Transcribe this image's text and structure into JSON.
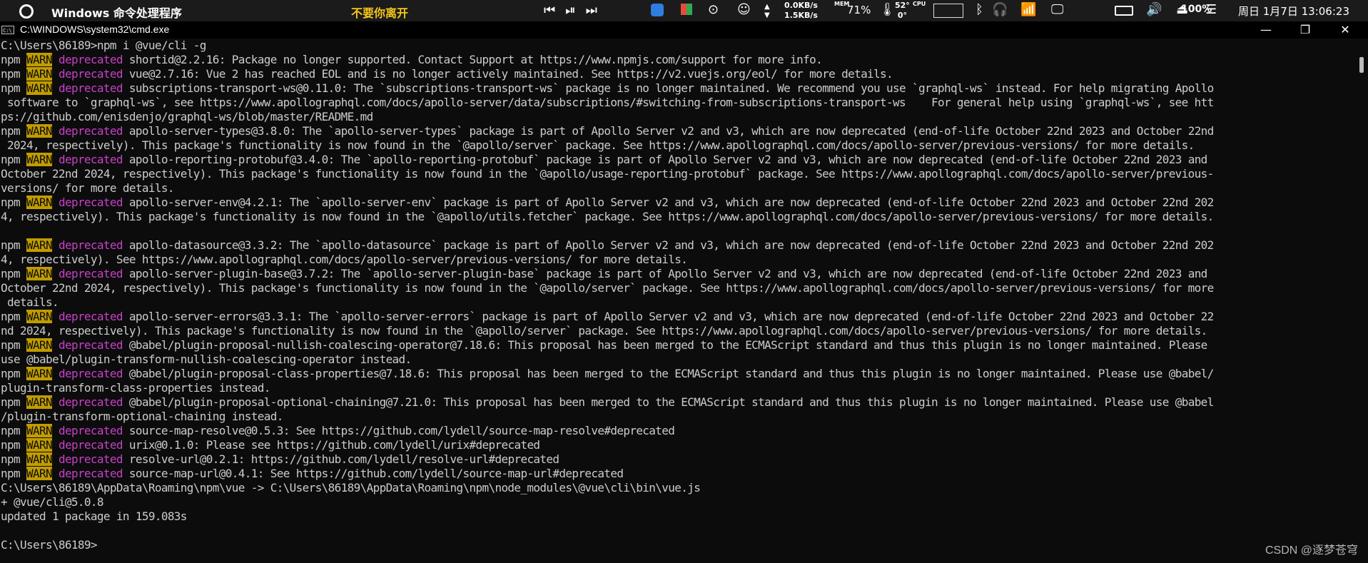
{
  "taskbar": {
    "app_title": "Windows 命令处理程序",
    "now_playing": "不要你离开",
    "net_up": "0.0KB/s",
    "net_down": "1.5KB/s",
    "mem_label": "MEM",
    "mem_value": "71%",
    "cpu_temp": "52°",
    "cpu_extra": "0°",
    "cpu_label": "CPU",
    "battery_pct": "100%",
    "clock": "周日 1月7日 13:06:23",
    "icons": [
      "circle-start-icon",
      "previous-track-icon",
      "play-pause-icon",
      "next-track-icon",
      "app-tray-icon",
      "colorful-tray-icon",
      "media-tray-icon",
      "user-tray-icon",
      "network-speed-arrows-icon",
      "thermometer-icon",
      "cpu-graph-icon",
      "bluetooth-icon",
      "headphones-icon",
      "wifi-icon",
      "display-icon",
      "battery-icon",
      "volume-icon",
      "eject-icon",
      "toggle-icon"
    ]
  },
  "window": {
    "title": "C:\\WINDOWS\\system32\\cmd.exe",
    "icon_text": "C:\\",
    "minimize": "—",
    "maximize": "❐",
    "close": "✕"
  },
  "terminal_lines": [
    {
      "text": "C:\\Users\\86189>npm i @vue/cli -g"
    },
    {
      "prefix": "npm ",
      "warn": "WARN",
      "dep": " deprecated",
      "rest": " shortid@2.2.16: Package no longer supported. Contact Support at https://www.npmjs.com/support for more info."
    },
    {
      "prefix": "npm ",
      "warn": "WARN",
      "dep": " deprecated",
      "rest": " vue@2.7.16: Vue 2 has reached EOL and is no longer actively maintained. See https://v2.vuejs.org/eol/ for more details."
    },
    {
      "prefix": "npm ",
      "warn": "WARN",
      "dep": " deprecated",
      "rest": " subscriptions-transport-ws@0.11.0: The `subscriptions-transport-ws` package is no longer maintained. We recommend you use `graphql-ws` instead. For help migrating Apollo"
    },
    {
      "text": " software to `graphql-ws`, see https://www.apollographql.com/docs/apollo-server/data/subscriptions/#switching-from-subscriptions-transport-ws    For general help using `graphql-ws`, see htt"
    },
    {
      "text": "ps://github.com/enisdenjo/graphql-ws/blob/master/README.md"
    },
    {
      "prefix": "npm ",
      "warn": "WARN",
      "dep": " deprecated",
      "rest": " apollo-server-types@3.8.0: The `apollo-server-types` package is part of Apollo Server v2 and v3, which are now deprecated (end-of-life October 22nd 2023 and October 22nd"
    },
    {
      "text": " 2024, respectively). This package's functionality is now found in the `@apollo/server` package. See https://www.apollographql.com/docs/apollo-server/previous-versions/ for more details."
    },
    {
      "prefix": "npm ",
      "warn": "WARN",
      "dep": " deprecated",
      "rest": " apollo-reporting-protobuf@3.4.0: The `apollo-reporting-protobuf` package is part of Apollo Server v2 and v3, which are now deprecated (end-of-life October 22nd 2023 and"
    },
    {
      "text": "October 22nd 2024, respectively). This package's functionality is now found in the `@apollo/usage-reporting-protobuf` package. See https://www.apollographql.com/docs/apollo-server/previous-"
    },
    {
      "text": "versions/ for more details."
    },
    {
      "prefix": "npm ",
      "warn": "WARN",
      "dep": " deprecated",
      "rest": " apollo-server-env@4.2.1: The `apollo-server-env` package is part of Apollo Server v2 and v3, which are now deprecated (end-of-life October 22nd 2023 and October 22nd 202"
    },
    {
      "text": "4, respectively). This package's functionality is now found in the `@apollo/utils.fetcher` package. See https://www.apollographql.com/docs/apollo-server/previous-versions/ for more details."
    },
    {
      "text": ""
    },
    {
      "prefix": "npm ",
      "warn": "WARN",
      "dep": " deprecated",
      "rest": " apollo-datasource@3.3.2: The `apollo-datasource` package is part of Apollo Server v2 and v3, which are now deprecated (end-of-life October 22nd 2023 and October 22nd 202"
    },
    {
      "text": "4, respectively). See https://www.apollographql.com/docs/apollo-server/previous-versions/ for more details."
    },
    {
      "prefix": "npm ",
      "warn": "WARN",
      "dep": " deprecated",
      "rest": " apollo-server-plugin-base@3.7.2: The `apollo-server-plugin-base` package is part of Apollo Server v2 and v3, which are now deprecated (end-of-life October 22nd 2023 and"
    },
    {
      "text": "October 22nd 2024, respectively). This package's functionality is now found in the `@apollo/server` package. See https://www.apollographql.com/docs/apollo-server/previous-versions/ for more"
    },
    {
      "text": " details."
    },
    {
      "prefix": "npm ",
      "warn": "WARN",
      "dep": " deprecated",
      "rest": " apollo-server-errors@3.3.1: The `apollo-server-errors` package is part of Apollo Server v2 and v3, which are now deprecated (end-of-life October 22nd 2023 and October 22"
    },
    {
      "text": "nd 2024, respectively). This package's functionality is now found in the `@apollo/server` package. See https://www.apollographql.com/docs/apollo-server/previous-versions/ for more details."
    },
    {
      "prefix": "npm ",
      "warn": "WARN",
      "dep": " deprecated",
      "rest": " @babel/plugin-proposal-nullish-coalescing-operator@7.18.6: This proposal has been merged to the ECMAScript standard and thus this plugin is no longer maintained. Please"
    },
    {
      "text": "use @babel/plugin-transform-nullish-coalescing-operator instead."
    },
    {
      "prefix": "npm ",
      "warn": "WARN",
      "dep": " deprecated",
      "rest": " @babel/plugin-proposal-class-properties@7.18.6: This proposal has been merged to the ECMAScript standard and thus this plugin is no longer maintained. Please use @babel/"
    },
    {
      "text": "plugin-transform-class-properties instead."
    },
    {
      "prefix": "npm ",
      "warn": "WARN",
      "dep": " deprecated",
      "rest": " @babel/plugin-proposal-optional-chaining@7.21.0: This proposal has been merged to the ECMAScript standard and thus this plugin is no longer maintained. Please use @babel"
    },
    {
      "text": "/plugin-transform-optional-chaining instead."
    },
    {
      "prefix": "npm ",
      "warn": "WARN",
      "dep": " deprecated",
      "rest": " source-map-resolve@0.5.3: See https://github.com/lydell/source-map-resolve#deprecated"
    },
    {
      "prefix": "npm ",
      "warn": "WARN",
      "dep": " deprecated",
      "rest": " urix@0.1.0: Please see https://github.com/lydell/urix#deprecated"
    },
    {
      "prefix": "npm ",
      "warn": "WARN",
      "dep": " deprecated",
      "rest": " resolve-url@0.2.1: https://github.com/lydell/resolve-url#deprecated"
    },
    {
      "prefix": "npm ",
      "warn": "WARN",
      "dep": " deprecated",
      "rest": " source-map-url@0.4.1: See https://github.com/lydell/source-map-url#deprecated"
    },
    {
      "text": "C:\\Users\\86189\\AppData\\Roaming\\npm\\vue -> C:\\Users\\86189\\AppData\\Roaming\\npm\\node_modules\\@vue\\cli\\bin\\vue.js"
    },
    {
      "text": "+ @vue/cli@5.0.8"
    },
    {
      "text": "updated 1 package in 159.083s"
    },
    {
      "text": ""
    },
    {
      "text": "C:\\Users\\86189>"
    }
  ],
  "watermark": "CSDN @逐梦苍穹"
}
